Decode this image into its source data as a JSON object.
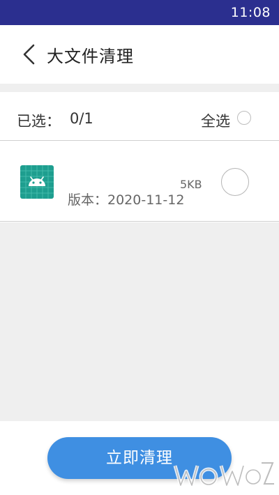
{
  "status_bar": {
    "time": "11:08",
    "color": "#2b2f8f"
  },
  "header": {
    "title": "大文件清理",
    "back_icon": "chevron-left-icon"
  },
  "selection": {
    "label": "已选：",
    "count": "0/1",
    "select_all_label": "全选"
  },
  "files": [
    {
      "icon": "android-icon",
      "size": "5KB",
      "version": "版本：2020-11-12"
    }
  ],
  "actions": {
    "clean_label": "立即清理",
    "accent": "#3f8fe2"
  }
}
